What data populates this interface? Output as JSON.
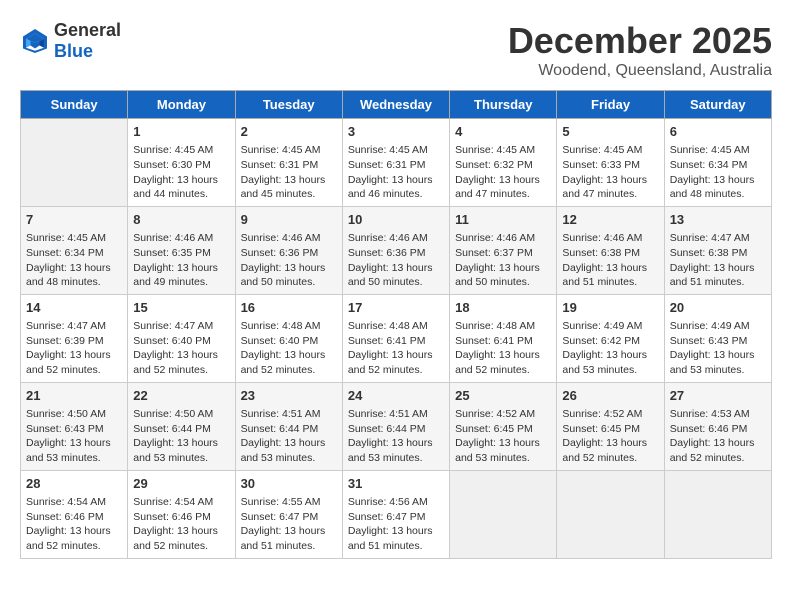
{
  "header": {
    "logo_general": "General",
    "logo_blue": "Blue",
    "month": "December 2025",
    "location": "Woodend, Queensland, Australia"
  },
  "days_of_week": [
    "Sunday",
    "Monday",
    "Tuesday",
    "Wednesday",
    "Thursday",
    "Friday",
    "Saturday"
  ],
  "weeks": [
    [
      {
        "day": "",
        "content": ""
      },
      {
        "day": "1",
        "content": "Sunrise: 4:45 AM\nSunset: 6:30 PM\nDaylight: 13 hours\nand 44 minutes."
      },
      {
        "day": "2",
        "content": "Sunrise: 4:45 AM\nSunset: 6:31 PM\nDaylight: 13 hours\nand 45 minutes."
      },
      {
        "day": "3",
        "content": "Sunrise: 4:45 AM\nSunset: 6:31 PM\nDaylight: 13 hours\nand 46 minutes."
      },
      {
        "day": "4",
        "content": "Sunrise: 4:45 AM\nSunset: 6:32 PM\nDaylight: 13 hours\nand 47 minutes."
      },
      {
        "day": "5",
        "content": "Sunrise: 4:45 AM\nSunset: 6:33 PM\nDaylight: 13 hours\nand 47 minutes."
      },
      {
        "day": "6",
        "content": "Sunrise: 4:45 AM\nSunset: 6:34 PM\nDaylight: 13 hours\nand 48 minutes."
      }
    ],
    [
      {
        "day": "7",
        "content": "Sunrise: 4:45 AM\nSunset: 6:34 PM\nDaylight: 13 hours\nand 48 minutes."
      },
      {
        "day": "8",
        "content": "Sunrise: 4:46 AM\nSunset: 6:35 PM\nDaylight: 13 hours\nand 49 minutes."
      },
      {
        "day": "9",
        "content": "Sunrise: 4:46 AM\nSunset: 6:36 PM\nDaylight: 13 hours\nand 50 minutes."
      },
      {
        "day": "10",
        "content": "Sunrise: 4:46 AM\nSunset: 6:36 PM\nDaylight: 13 hours\nand 50 minutes."
      },
      {
        "day": "11",
        "content": "Sunrise: 4:46 AM\nSunset: 6:37 PM\nDaylight: 13 hours\nand 50 minutes."
      },
      {
        "day": "12",
        "content": "Sunrise: 4:46 AM\nSunset: 6:38 PM\nDaylight: 13 hours\nand 51 minutes."
      },
      {
        "day": "13",
        "content": "Sunrise: 4:47 AM\nSunset: 6:38 PM\nDaylight: 13 hours\nand 51 minutes."
      }
    ],
    [
      {
        "day": "14",
        "content": "Sunrise: 4:47 AM\nSunset: 6:39 PM\nDaylight: 13 hours\nand 52 minutes."
      },
      {
        "day": "15",
        "content": "Sunrise: 4:47 AM\nSunset: 6:40 PM\nDaylight: 13 hours\nand 52 minutes."
      },
      {
        "day": "16",
        "content": "Sunrise: 4:48 AM\nSunset: 6:40 PM\nDaylight: 13 hours\nand 52 minutes."
      },
      {
        "day": "17",
        "content": "Sunrise: 4:48 AM\nSunset: 6:41 PM\nDaylight: 13 hours\nand 52 minutes."
      },
      {
        "day": "18",
        "content": "Sunrise: 4:48 AM\nSunset: 6:41 PM\nDaylight: 13 hours\nand 52 minutes."
      },
      {
        "day": "19",
        "content": "Sunrise: 4:49 AM\nSunset: 6:42 PM\nDaylight: 13 hours\nand 53 minutes."
      },
      {
        "day": "20",
        "content": "Sunrise: 4:49 AM\nSunset: 6:43 PM\nDaylight: 13 hours\nand 53 minutes."
      }
    ],
    [
      {
        "day": "21",
        "content": "Sunrise: 4:50 AM\nSunset: 6:43 PM\nDaylight: 13 hours\nand 53 minutes."
      },
      {
        "day": "22",
        "content": "Sunrise: 4:50 AM\nSunset: 6:44 PM\nDaylight: 13 hours\nand 53 minutes."
      },
      {
        "day": "23",
        "content": "Sunrise: 4:51 AM\nSunset: 6:44 PM\nDaylight: 13 hours\nand 53 minutes."
      },
      {
        "day": "24",
        "content": "Sunrise: 4:51 AM\nSunset: 6:44 PM\nDaylight: 13 hours\nand 53 minutes."
      },
      {
        "day": "25",
        "content": "Sunrise: 4:52 AM\nSunset: 6:45 PM\nDaylight: 13 hours\nand 53 minutes."
      },
      {
        "day": "26",
        "content": "Sunrise: 4:52 AM\nSunset: 6:45 PM\nDaylight: 13 hours\nand 52 minutes."
      },
      {
        "day": "27",
        "content": "Sunrise: 4:53 AM\nSunset: 6:46 PM\nDaylight: 13 hours\nand 52 minutes."
      }
    ],
    [
      {
        "day": "28",
        "content": "Sunrise: 4:54 AM\nSunset: 6:46 PM\nDaylight: 13 hours\nand 52 minutes."
      },
      {
        "day": "29",
        "content": "Sunrise: 4:54 AM\nSunset: 6:46 PM\nDaylight: 13 hours\nand 52 minutes."
      },
      {
        "day": "30",
        "content": "Sunrise: 4:55 AM\nSunset: 6:47 PM\nDaylight: 13 hours\nand 51 minutes."
      },
      {
        "day": "31",
        "content": "Sunrise: 4:56 AM\nSunset: 6:47 PM\nDaylight: 13 hours\nand 51 minutes."
      },
      {
        "day": "",
        "content": ""
      },
      {
        "day": "",
        "content": ""
      },
      {
        "day": "",
        "content": ""
      }
    ]
  ]
}
